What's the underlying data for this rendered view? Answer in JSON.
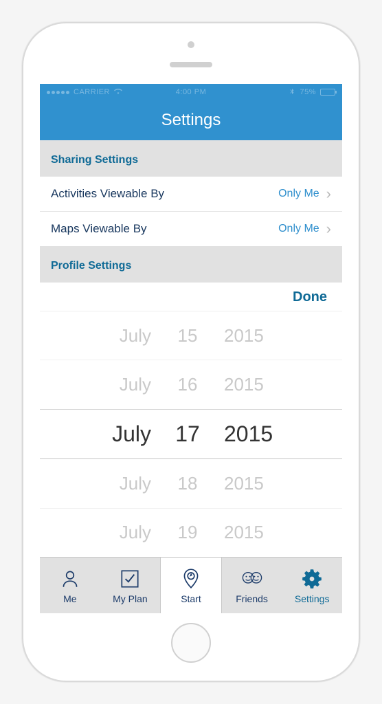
{
  "statusbar": {
    "carrier": "CARRIER",
    "time": "4:00 PM",
    "battery": "75%"
  },
  "header": {
    "title": "Settings"
  },
  "sections": {
    "sharing": {
      "title": "Sharing Settings",
      "rows": [
        {
          "label": "Activities Viewable By",
          "value": "Only Me"
        },
        {
          "label": "Maps Viewable By",
          "value": "Only Me"
        }
      ]
    },
    "profile": {
      "title": "Profile Settings"
    }
  },
  "picker": {
    "done": "Done",
    "rows": [
      {
        "month": "July",
        "day": "15",
        "year": "2015"
      },
      {
        "month": "July",
        "day": "16",
        "year": "2015"
      },
      {
        "month": "July",
        "day": "17",
        "year": "2015"
      },
      {
        "month": "July",
        "day": "18",
        "year": "2015"
      },
      {
        "month": "July",
        "day": "19",
        "year": "2015"
      }
    ],
    "selected_index": 2
  },
  "tabbar": {
    "items": [
      {
        "label": "Me"
      },
      {
        "label": "My Plan"
      },
      {
        "label": "Start"
      },
      {
        "label": "Friends"
      },
      {
        "label": "Settings"
      }
    ]
  }
}
